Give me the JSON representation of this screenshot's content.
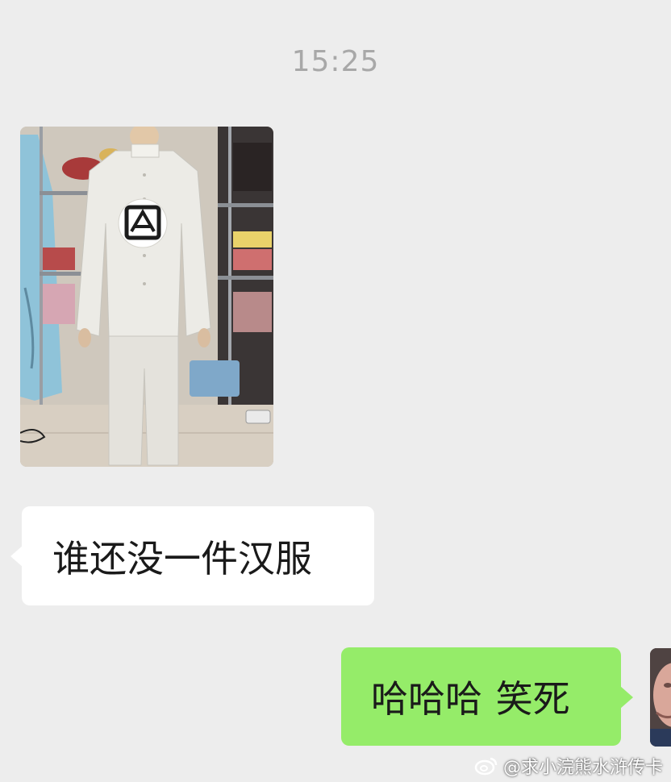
{
  "chat": {
    "timestamp": "15:25",
    "messages": [
      {
        "side": "incoming",
        "type": "image",
        "description_icon": "photo-icon"
      },
      {
        "side": "incoming",
        "type": "text",
        "text": "谁还没一件汉服"
      },
      {
        "side": "outgoing",
        "type": "text",
        "text": "哈哈哈 笑死"
      }
    ]
  },
  "watermark": {
    "text": "@求小浣熊水浒传卡",
    "icon": "weibo-icon"
  },
  "colors": {
    "background": "#ededed",
    "incoming_bubble": "#ffffff",
    "outgoing_bubble": "#95ec69",
    "timestamp": "#a8a8a8"
  }
}
